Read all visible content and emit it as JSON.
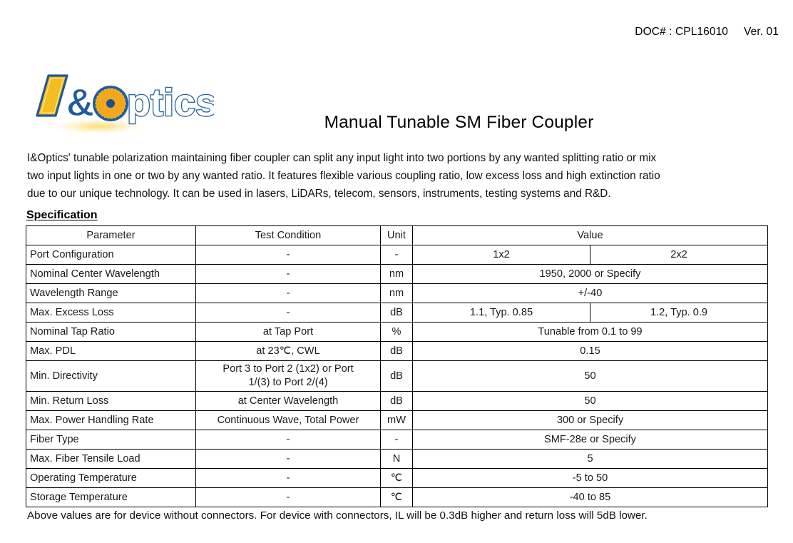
{
  "header": {
    "doc_label": "DOC# : CPL16010",
    "version": "Ver. 01"
  },
  "logo": {
    "text": "I&Optics",
    "colors": {
      "gold": "#F5BE20",
      "blue": "#1F5C9E",
      "outline": "#2A5F8F",
      "dot": "#1B4F8C"
    }
  },
  "title": "Manual Tunable SM Fiber Coupler",
  "intro": {
    "line1": "I&Optics' tunable polarization maintaining fiber coupler can split any input light into two portions by any wanted splitting ratio or mix",
    "line2": "two input lights in one or two by any wanted ratio. It features flexible various coupling ratio, low excess loss and high extinction ratio",
    "line3": "due to our unique technology. It can be used in lasers, LiDARs, telecom, sensors, instruments, testing systems and R&D."
  },
  "spec_heading": "Specification",
  "table": {
    "headers": {
      "parameter": "Parameter",
      "test_condition": "Test Condition",
      "unit": "Unit",
      "value": "Value"
    },
    "rows": [
      {
        "parameter": "Port Configuration",
        "test_condition": "-",
        "unit": "-",
        "value_1x2": "1x2",
        "value_2x2": "2x2",
        "split": true
      },
      {
        "parameter": "Nominal Center Wavelength",
        "test_condition": "-",
        "unit": "nm",
        "value": "1950, 2000 or Specify",
        "split": false
      },
      {
        "parameter": "Wavelength Range",
        "test_condition": "-",
        "unit": "nm",
        "value": "+/-40",
        "split": false
      },
      {
        "parameter": "Max. Excess Loss",
        "test_condition": "-",
        "unit": "dB",
        "value_1x2": "1.1, Typ. 0.85",
        "value_2x2": "1.2, Typ. 0.9",
        "split": true
      },
      {
        "parameter": "Nominal Tap Ratio",
        "test_condition": "at Tap Port",
        "unit": "%",
        "value": "Tunable from 0.1 to 99",
        "split": false
      },
      {
        "parameter": "Max. PDL",
        "test_condition": "at 23℃, CWL",
        "unit": "dB",
        "value": "0.15",
        "split": false
      },
      {
        "parameter": "Min. Directivity",
        "test_condition_line1": "Port 3 to Port 2 (1x2) or Port",
        "test_condition_line2": "1/(3) to Port 2/(4)",
        "unit": "dB",
        "value": "50",
        "split": false,
        "tall": true
      },
      {
        "parameter": "Min. Return Loss",
        "test_condition": "at Center Wavelength",
        "unit": "dB",
        "value": "50",
        "split": false
      },
      {
        "parameter": "Max. Power Handling Rate",
        "test_condition": "Continuous Wave, Total Power",
        "unit": "mW",
        "value": "300 or Specify",
        "split": false
      },
      {
        "parameter": "Fiber Type",
        "test_condition": "-",
        "unit": "-",
        "value": "SMF-28e or Specify",
        "split": false
      },
      {
        "parameter": "Max. Fiber Tensile Load",
        "test_condition": "-",
        "unit": "N",
        "value": "5",
        "split": false
      },
      {
        "parameter": "Operating Temperature",
        "test_condition": "-",
        "unit": "℃",
        "value": "-5 to 50",
        "split": false
      },
      {
        "parameter": "Storage Temperature",
        "test_condition": "-",
        "unit": "℃",
        "value": "-40 to 85",
        "split": false
      }
    ]
  },
  "footer_note": "Above values are for device without connectors. For device with connectors, IL will be 0.3dB higher and return loss will 5dB lower."
}
